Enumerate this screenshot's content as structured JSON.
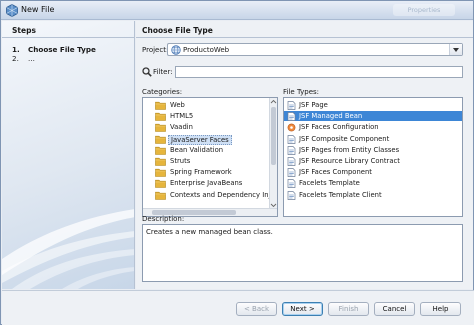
{
  "window": {
    "title": "New File",
    "ghost_title": "Properties"
  },
  "steps": {
    "header": "Steps",
    "items": [
      {
        "num": "1.",
        "label": "Choose File Type"
      },
      {
        "num": "2.",
        "label": "..."
      }
    ]
  },
  "main": {
    "header": "Choose File Type",
    "project_label": "Project:",
    "project_value": "ProductoWeb",
    "filter_label": "Filter:",
    "filter_value": "",
    "categories_label": "Categories:",
    "categories": [
      "Web",
      "HTML5",
      "Vaadin",
      "JavaServer Faces",
      "Bean Validation",
      "Struts",
      "Spring Framework",
      "Enterprise JavaBeans",
      "Contexts and Dependency Inj"
    ],
    "categories_selected": "JavaServer Faces",
    "file_types_label": "File Types:",
    "file_types": [
      "JSF Page",
      "JSF Managed Bean",
      "JSF Faces Configuration",
      "JSF Composite Component",
      "JSF Pages from Entity Classes",
      "JSF Resource Library Contract",
      "JSF Faces Component",
      "Facelets Template",
      "Facelets Template Client"
    ],
    "file_types_selected": "JSF Managed Bean",
    "description_label": "Description:",
    "description_text": "Creates a new managed bean class."
  },
  "buttons": {
    "back": "< Back",
    "next": "Next >",
    "finish": "Finish",
    "cancel": "Cancel",
    "help": "Help"
  },
  "colors": {
    "selection": "#3d86d6",
    "folder": "#e6b53c"
  }
}
